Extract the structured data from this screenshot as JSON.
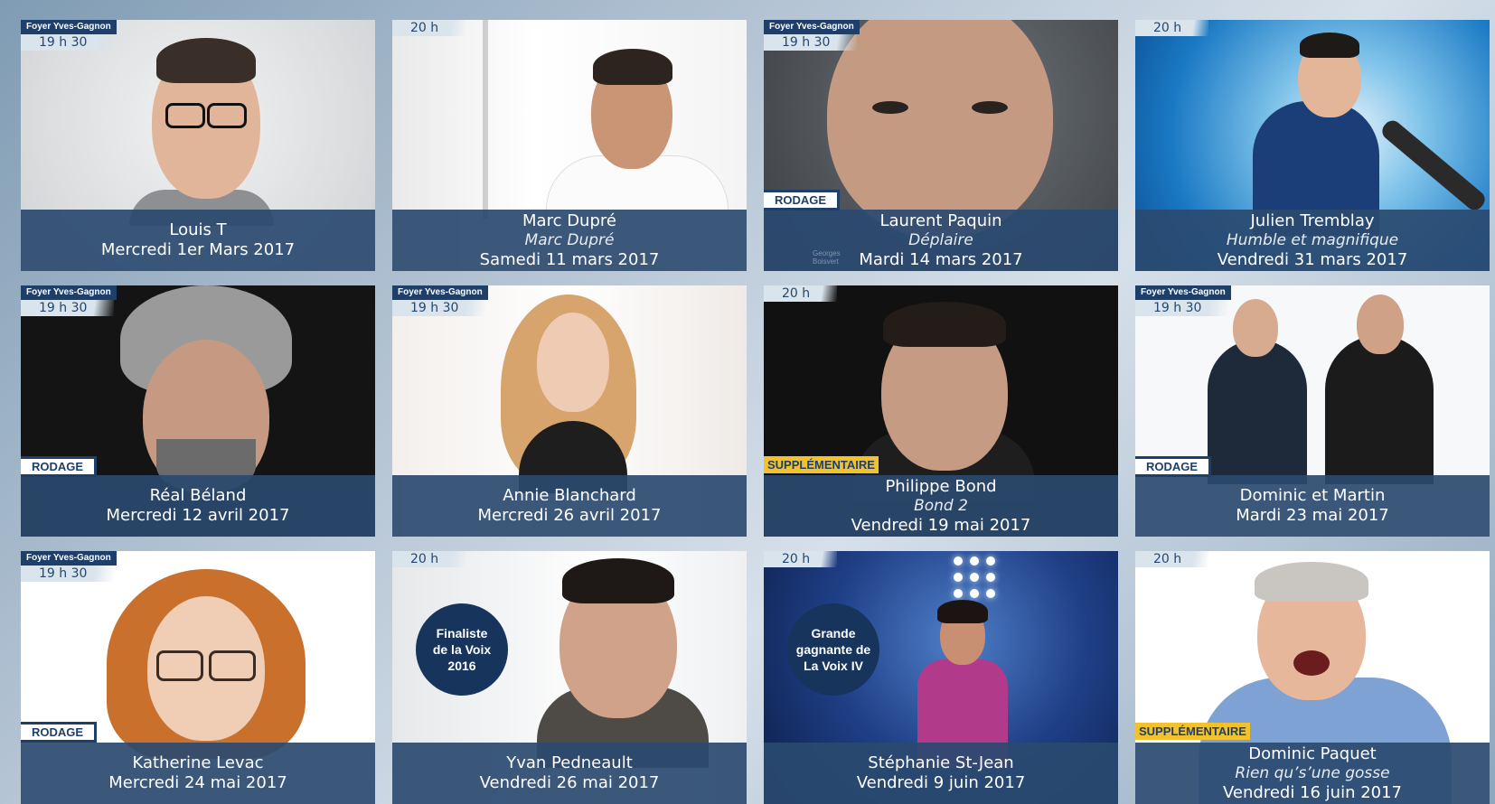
{
  "cards": [
    {
      "venue": "Foyer Yves-Gagnon",
      "time": "19 h 30",
      "name": "Louis T",
      "show": "",
      "date": "Mercredi 1er Mars 2017",
      "badge": ""
    },
    {
      "venue": "",
      "time": "20 h",
      "name": "Marc Dupré",
      "show": "Marc Dupré",
      "date": "Samedi 11 mars 2017",
      "badge": ""
    },
    {
      "venue": "Foyer Yves-Gagnon",
      "time": "19 h 30",
      "name": "Laurent Paquin",
      "show": "Déplaire",
      "date": "Mardi 14 mars 2017",
      "badge": "RODAGE"
    },
    {
      "venue": "",
      "time": "20 h",
      "name": "Julien Tremblay",
      "show": "Humble et magnifique",
      "date": "Vendredi 31 mars 2017",
      "badge": ""
    },
    {
      "venue": "Foyer Yves-Gagnon",
      "time": "19 h 30",
      "name": "Réal Béland",
      "show": "",
      "date": "Mercredi 12 avril 2017",
      "badge": "RODAGE"
    },
    {
      "venue": "Foyer Yves-Gagnon",
      "time": "19 h 30",
      "name": "Annie Blanchard",
      "show": "",
      "date": "Mercredi 26 avril 2017",
      "badge": ""
    },
    {
      "venue": "",
      "time": "20 h",
      "name": "Philippe Bond",
      "show": "Bond 2",
      "date": "Vendredi 19 mai 2017",
      "badge": "SUPPLÉMENTAIRE"
    },
    {
      "venue": "Foyer Yves-Gagnon",
      "time": "19 h 30",
      "name": "Dominic et Martin",
      "show": "",
      "date": "Mardi 23 mai 2017",
      "badge": "RODAGE"
    },
    {
      "venue": "Foyer Yves-Gagnon",
      "time": "19 h 30",
      "name": "Katherine Levac",
      "show": "",
      "date": "Mercredi 24 mai 2017",
      "badge": "RODAGE"
    },
    {
      "venue": "",
      "time": "20 h",
      "name": "Yvan Pedneault",
      "show": "",
      "date": "Vendredi 26 mai 2017",
      "badge": "",
      "circle": [
        "Finaliste",
        "de la Voix",
        "2016"
      ]
    },
    {
      "venue": "",
      "time": "20 h",
      "name": "Stéphanie St-Jean",
      "show": "",
      "date": "Vendredi 9 juin 2017",
      "badge": "",
      "circle": [
        "Grande",
        "gagnante de",
        "La Voix IV"
      ]
    },
    {
      "venue": "",
      "time": "20 h",
      "name": "Dominic Paquet",
      "show": "Rien qu’s’une gosse",
      "date": "Vendredi 16 juin 2017",
      "badge": "SUPPLÉMENTAIRE"
    }
  ],
  "watermark": [
    "Georges",
    "Boisvert"
  ],
  "colors": {
    "caption": "#2a4a70",
    "venue": "#1f3f6b",
    "supplementaire": "#f2c12e"
  }
}
